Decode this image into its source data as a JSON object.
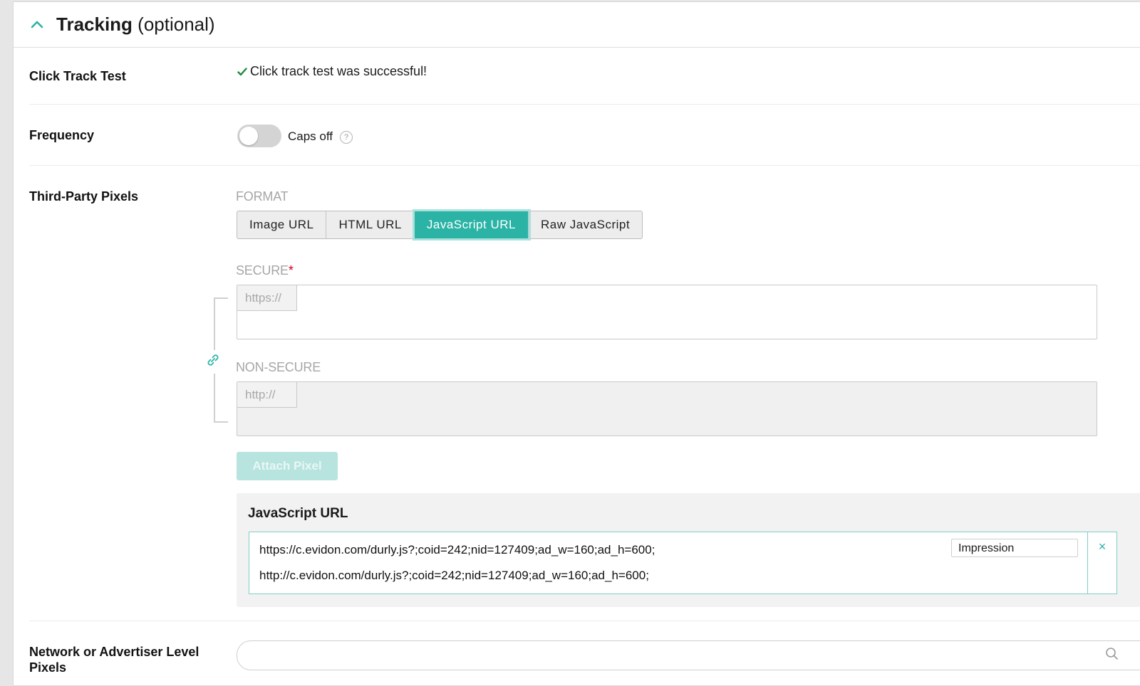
{
  "section": {
    "title": "Tracking",
    "title_suffix": "(optional)"
  },
  "click_track": {
    "label": "Click Track Test",
    "status_text": "Click track test was successful!"
  },
  "frequency": {
    "label": "Frequency",
    "toggle_on": false,
    "toggle_text": "Caps off",
    "help_glyph": "?"
  },
  "third_party": {
    "label": "Third-Party Pixels",
    "format_caption": "FORMAT",
    "formats": [
      "Image URL",
      "HTML URL",
      "JavaScript URL",
      "Raw JavaScript"
    ],
    "selected_format": "JavaScript URL",
    "secure_caption": "SECURE",
    "required_mark": "*",
    "secure_prefix": "https://",
    "secure_value": "",
    "nonsecure_caption": "NON-SECURE",
    "nonsecure_prefix": "http://",
    "nonsecure_value": "",
    "attach_label": "Attach Pixel",
    "attached": {
      "title": "JavaScript URL",
      "secure_url": "https://c.evidon.com/durly.js?;coid=242;nid=127409;ad_w=160;ad_h=600;",
      "nonsecure_url": "http://c.evidon.com/durly.js?;coid=242;nid=127409;ad_w=160;ad_h=600;",
      "event_type": "Impression",
      "remove_glyph": "×"
    }
  },
  "network_pixels": {
    "label": "Network or Advertiser Level Pixels",
    "search_value": ""
  },
  "colors": {
    "accent": "#2bb3a6",
    "accent_disabled": "#b8e4df",
    "required": "#d0021b"
  },
  "icons": [
    "chevron-up-icon",
    "check-icon",
    "help-icon",
    "link-icon",
    "close-icon",
    "search-icon"
  ]
}
